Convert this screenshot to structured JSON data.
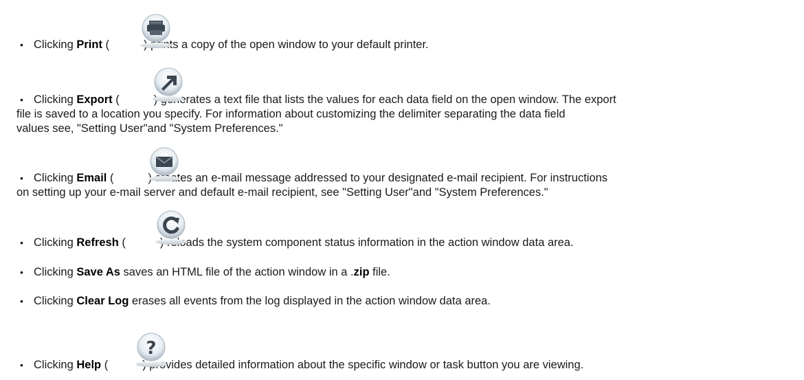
{
  "items": [
    {
      "prefix": "Clicking ",
      "name": "Print",
      "open": " (",
      "after": ") prints a copy of the open window to your default printer.",
      "icon": "printer-icon"
    },
    {
      "prefix": "Clicking ",
      "name": "Export",
      "open": " (",
      "after": ") generates a text file that lists the values for each data field on the open window. The export",
      "line2": "file is saved to a location you specify. For information about customizing the delimiter separating the data field",
      "line3": "values see, \"Setting User\"and \"System Preferences.\"",
      "icon": "export-arrow-icon"
    },
    {
      "prefix": "Clicking ",
      "name": "Email",
      "open": " (",
      "after": ") creates an e-mail message addressed to your designated e-mail recipient. For instructions",
      "line2": "on setting up your e-mail server and default e-mail recipient, see \"Setting User\"and \"System Preferences.\"",
      "icon": "envelope-icon"
    },
    {
      "prefix": "Clicking ",
      "name": "Refresh",
      "open": " (",
      "after": ") reloads the system component status information in the action window data area.",
      "icon": "refresh-icon"
    },
    {
      "prefix": "Clicking ",
      "name": "Save As",
      "after_a": " saves an HTML file of the action window in a .",
      "bold2": "zip",
      "after_b": " file."
    },
    {
      "prefix": "Clicking ",
      "name": "Clear Log",
      "after": " erases all events from the log displayed in the action window data area."
    },
    {
      "prefix": "Clicking ",
      "name": "Help",
      "open": " (",
      "after": ") provides detailed information about the specific window or task button you are viewing.",
      "icon": "help-question-icon"
    }
  ],
  "bullet": "•"
}
